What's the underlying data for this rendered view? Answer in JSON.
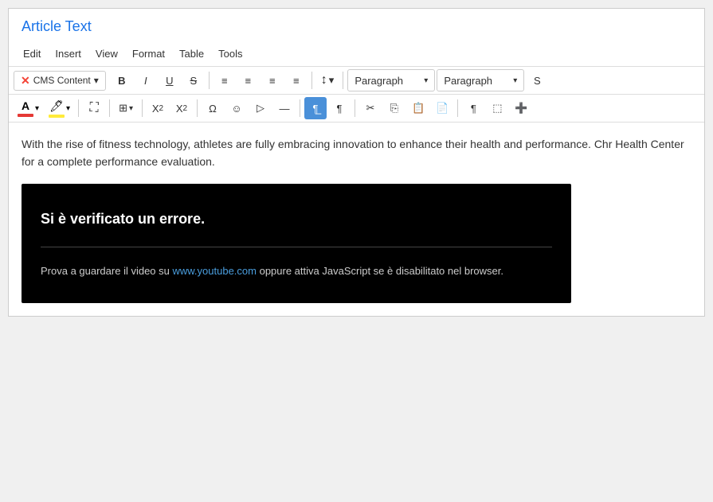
{
  "page": {
    "title": "Article Text"
  },
  "menu": {
    "items": [
      {
        "id": "edit",
        "label": "Edit"
      },
      {
        "id": "insert",
        "label": "Insert"
      },
      {
        "id": "view",
        "label": "View"
      },
      {
        "id": "format",
        "label": "Format"
      },
      {
        "id": "table",
        "label": "Table"
      },
      {
        "id": "tools",
        "label": "Tools"
      }
    ]
  },
  "toolbar1": {
    "cms_badge": "CMS Content",
    "paragraph_dropdown1": "Paragraph",
    "paragraph_dropdown2": "Paragraph"
  },
  "content": {
    "article_text": "With the rise of fitness technology, athletes are fully embracing innovation to enhance their health and performance. Chr Health Center for a complete performance evaluation.",
    "video_error": {
      "title": "Si è verificato un errore.",
      "detail_prefix": "Prova a guardare il video su ",
      "link_text": "www.youtube.com",
      "detail_suffix": " oppure attiva JavaScript se è disabilitato nel browser."
    }
  },
  "colors": {
    "accent_blue": "#1a73e8",
    "active_btn": "#4a90d9",
    "joomla_red": "#f44336"
  }
}
